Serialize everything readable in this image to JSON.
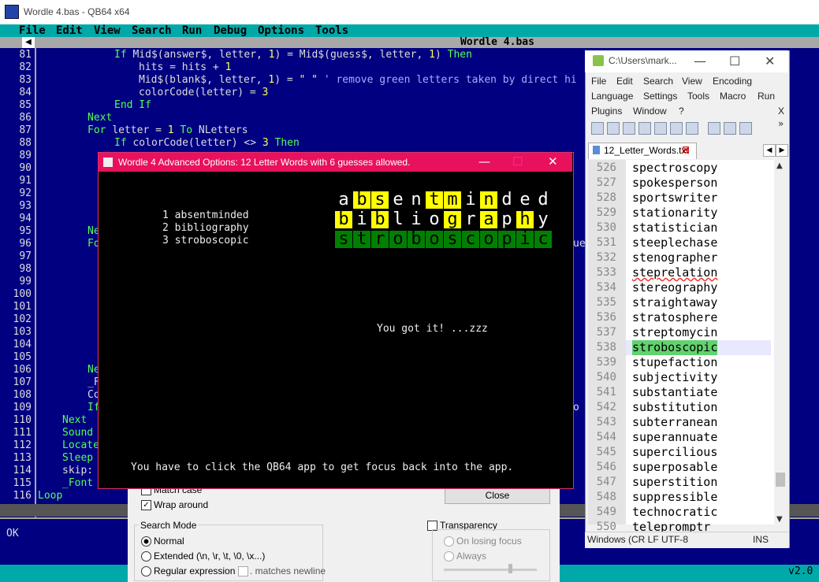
{
  "qb": {
    "title": "Wordle 4.bas - QB64 x64",
    "menu": [
      "File",
      "Edit",
      "View",
      "Search",
      "Run",
      "Debug",
      "Options",
      "Tools"
    ],
    "file_title": "Wordle 4.bas",
    "status": "OK",
    "version": "v2.0",
    "line_numbers": [
      "81",
      "82",
      "83",
      "84",
      "85",
      "86",
      "87",
      "88",
      "89",
      "90",
      "91",
      "92",
      "93",
      "94",
      "95",
      "96",
      "97",
      "98",
      "99",
      "100",
      "101",
      "102",
      "103",
      "104",
      "105",
      "106",
      "107",
      "108",
      "109",
      "110",
      "111",
      "112",
      "113",
      "114",
      "115",
      "116"
    ],
    "code": {
      "l81a": "If ",
      "l81b": "Mid$(answer$, letter, ",
      "l81c": "1",
      "l81d": ") = Mid$(guess$, letter, ",
      "l81e": "1",
      "l81f": ") ",
      "l81g": "Then",
      "l82a": "hits = hits + ",
      "l82b": "1",
      "l83a": "Mid$(blank$, letter, ",
      "l83b": "1",
      "l83c": ") = ",
      "l83d": "\" \"",
      "l83e": " ' remove green letters taken by direct hi",
      "l84a": "colorCode(letter) = ",
      "l84b": "3",
      "l85": "End If",
      "l86": "Next",
      "l87a": "For ",
      "l87b": "letter = ",
      "l87c": "1",
      "l87d": " To ",
      "l87e": "NLetters",
      "l88a": "If ",
      "l88b": "colorCode(letter) <> ",
      "l88c": "3",
      "l88d": " Then",
      "l95": "Ne",
      "l96": "Fo",
      "l96r": "ue",
      "l106": "Ne",
      "l107": "_F",
      "l108": "Co",
      "l109": "If",
      "l109r": "o",
      "l110": "Next",
      "l111": "Sound",
      "l112": "Locate",
      "l113": "Sleep",
      "l114": "skip:",
      "l115": "_Font",
      "l116": "Loop"
    }
  },
  "notepad": {
    "title": "C:\\Users\\mark...",
    "menu_row1": [
      "File",
      "Edit",
      "Search",
      "View",
      "Encoding"
    ],
    "menu_row2": [
      "Language",
      "Settings",
      "Tools",
      "Macro",
      "Run"
    ],
    "menu_row3": [
      "Plugins",
      "Window",
      "?"
    ],
    "menu_close": "X",
    "tab_label": "12_Letter_Words.txt",
    "line_numbers": [
      "526",
      "527",
      "528",
      "529",
      "530",
      "531",
      "532",
      "533",
      "534",
      "535",
      "536",
      "537",
      "538",
      "539",
      "540",
      "541",
      "542",
      "543",
      "544",
      "545",
      "546",
      "547",
      "548",
      "549",
      "550"
    ],
    "lines": [
      "spectroscopy",
      "spokesperson",
      "sportswriter",
      "stationarity",
      "statistician",
      "steeplechase",
      "stenographer",
      "steprelation",
      "stereography",
      "straightaway",
      "stratosphere",
      "streptomycin",
      "stroboscopic",
      "stupefaction",
      "subjectivity",
      "substantiate",
      "substitution",
      "subterranean",
      "superannuate",
      "supercilious",
      "superposable",
      "superstition",
      "suppressible",
      "technocratic",
      "telepromptr"
    ],
    "status_left": "Windows (CR LF UTF-8",
    "status_right": "INS"
  },
  "find": {
    "match_case": "Match case",
    "wrap_around": "Wrap around",
    "close": "Close",
    "search_mode": "Search Mode",
    "normal": "Normal",
    "extended": "Extended (\\n, \\r, \\t, \\0, \\x...)",
    "regex": "Regular expression",
    "matches_newline": ". matches newline",
    "transparency": "Transparency",
    "on_losing_focus": "On losing focus",
    "always": "Always"
  },
  "wordle": {
    "title": "Wordle 4 Advanced Options: 12 Letter Words with 6 guesses allowed.",
    "guesses": [
      "1 absentminded",
      "2 bibliography",
      "3 stroboscopic"
    ],
    "grid": [
      {
        "letters": "absentminded",
        "colors": "-yy--yy-y----"
      },
      {
        "letters": "bibliography",
        "colors": "y-y---y-y-y--"
      },
      {
        "letters": "stroboscopic",
        "colors": "gggggggggggg"
      }
    ],
    "message": "You got it! ...zzz",
    "hint": "You have to click the QB64 app to get focus back into the app."
  }
}
